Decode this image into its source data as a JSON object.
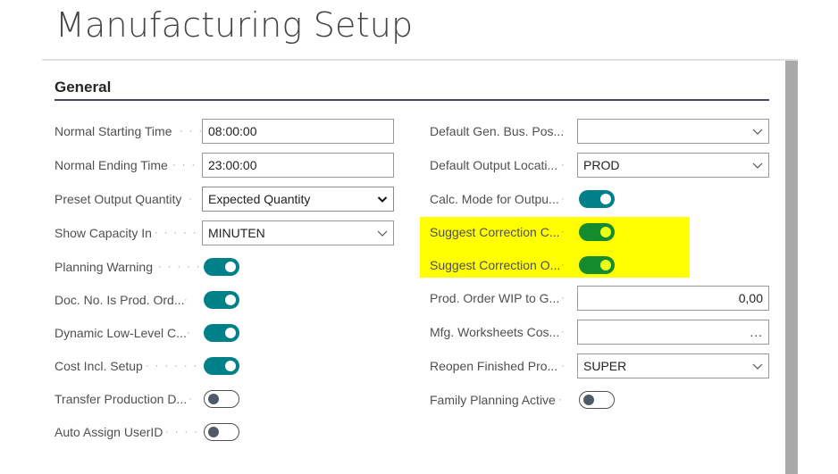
{
  "page": {
    "title": "Manufacturing Setup"
  },
  "section": {
    "header": "General"
  },
  "left": [
    {
      "label": "Normal Starting Time",
      "type": "text",
      "value": "08:00:00"
    },
    {
      "label": "Normal Ending Time",
      "type": "text",
      "value": "23:00:00"
    },
    {
      "label": "Preset Output Quantity",
      "type": "select",
      "value": "Expected Quantity"
    },
    {
      "label": "Show Capacity In",
      "type": "dropdown",
      "value": "MINUTEN"
    },
    {
      "label": "Planning Warning",
      "type": "toggle",
      "on": true
    },
    {
      "label": "Doc. No. Is Prod. Ord...",
      "type": "toggle",
      "on": true
    },
    {
      "label": "Dynamic Low-Level C...",
      "type": "toggle",
      "on": true
    },
    {
      "label": "Cost Incl. Setup",
      "type": "toggle",
      "on": true
    },
    {
      "label": "Transfer Production D...",
      "type": "toggle",
      "on": false
    },
    {
      "label": "Auto Assign UserID",
      "type": "toggle",
      "on": false
    }
  ],
  "right": [
    {
      "label": "Default Gen. Bus. Pos...",
      "type": "dropdown",
      "value": ""
    },
    {
      "label": "Default Output Locati...",
      "type": "dropdown",
      "value": "PROD"
    },
    {
      "label": "Calc. Mode for Outpu...",
      "type": "toggle",
      "on": true
    },
    {
      "label": "Suggest Correction C...",
      "type": "toggle",
      "on": true
    },
    {
      "label": "Suggest Correction O...",
      "type": "toggle",
      "on": true
    },
    {
      "label": "Prod. Order WIP to G...",
      "type": "number",
      "value": "0,00"
    },
    {
      "label": "Mfg. Worksheets Cos...",
      "type": "lookup",
      "value": "",
      "button": "..."
    },
    {
      "label": "Reopen Finished Pro...",
      "type": "dropdown",
      "value": "SUPER"
    },
    {
      "label": "Family Planning Active",
      "type": "toggle",
      "on": false
    }
  ],
  "colors": {
    "toggle_on": "#00818a",
    "toggle_on_highlighted": "#148b2d",
    "highlight": "#ffff00",
    "section_rule": "#454b59"
  }
}
